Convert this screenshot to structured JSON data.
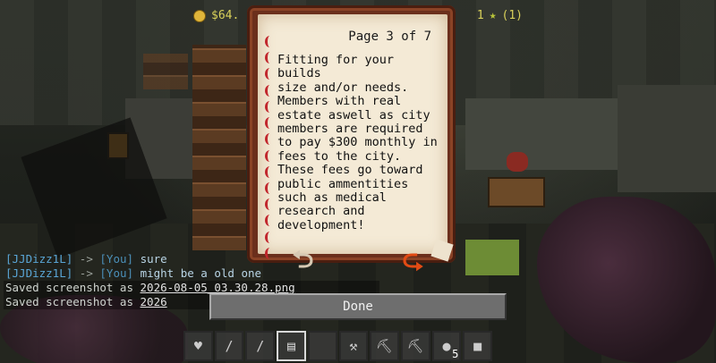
{
  "hud": {
    "money": "$64.",
    "right_text": "1",
    "star_count": "(1)"
  },
  "book": {
    "page_indicator": "Page 3 of 7",
    "text": "Fitting for your builds\nsize and/or needs.\nMembers with real\nestate aswell as city\nmembers are required\nto pay $300 monthly in\nfees to the city.\nThese fees go toward\npublic ammentities\nsuch as medical\nresearch and\ndevelopment!"
  },
  "chat": [
    {
      "name": "[JJDizz1L]",
      "arrow": "->",
      "you": "[You]",
      "msg": "sure"
    },
    {
      "name": "[JJDizz1L]",
      "arrow": "->",
      "you": "[You]",
      "msg": "might be a old one"
    },
    {
      "prefix": "Saved screenshot as",
      "file": "2026-08-05_03.30.28.png"
    },
    {
      "prefix": "Saved screenshot as",
      "file": "2026"
    }
  ],
  "done_button": "Done",
  "hotbar": {
    "selected_index": 3,
    "slots": [
      {
        "icon": "heart-item-icon",
        "glyph": "♥",
        "count": ""
      },
      {
        "icon": "crossbow-icon",
        "glyph": "/",
        "count": ""
      },
      {
        "icon": "bow-icon",
        "glyph": "/",
        "count": ""
      },
      {
        "icon": "book-icon",
        "glyph": "▤",
        "count": ""
      },
      {
        "icon": "empty-slot",
        "glyph": "",
        "count": ""
      },
      {
        "icon": "diamond-axe-icon",
        "glyph": "⚒",
        "count": ""
      },
      {
        "icon": "diamond-pickaxe-icon",
        "glyph": "⛏",
        "count": ""
      },
      {
        "icon": "pickaxe-icon",
        "glyph": "⛏",
        "count": ""
      },
      {
        "icon": "bread-icon",
        "glyph": "●",
        "count": "5"
      },
      {
        "icon": "block-icon",
        "glyph": "■",
        "count": ""
      }
    ]
  },
  "colors": {
    "book_cover": "#6b2f1c",
    "page": "#f4ead6",
    "next_arrow": "#e34b14",
    "hud_gold": "#d8d05a"
  }
}
